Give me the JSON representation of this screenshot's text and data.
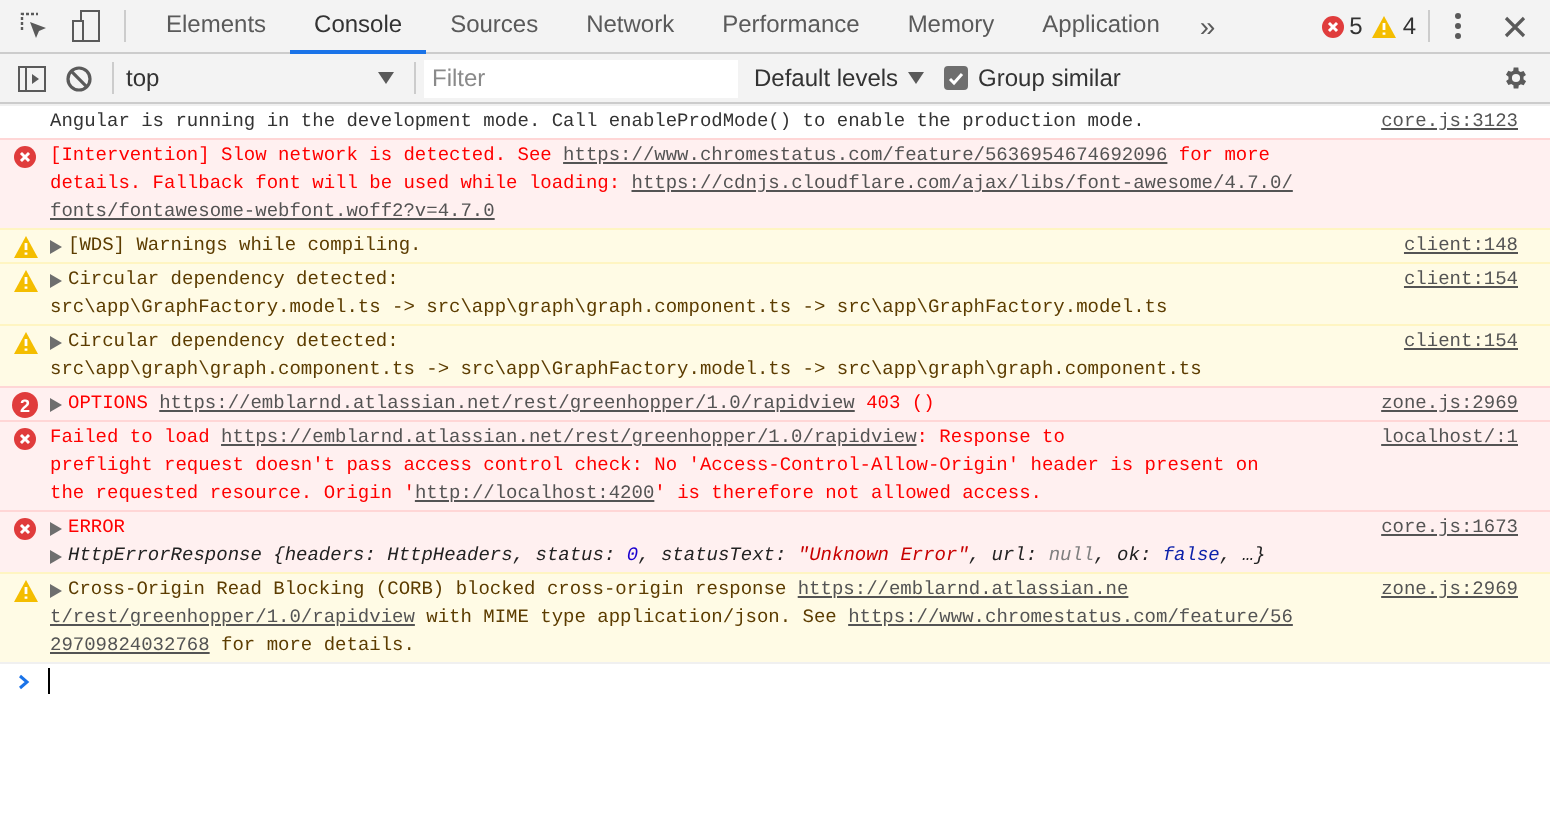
{
  "toolbar": {
    "tabs": [
      {
        "label": "Elements",
        "selected": false
      },
      {
        "label": "Console",
        "selected": true
      },
      {
        "label": "Sources",
        "selected": false
      },
      {
        "label": "Network",
        "selected": false
      },
      {
        "label": "Performance",
        "selected": false
      },
      {
        "label": "Memory",
        "selected": false
      },
      {
        "label": "Application",
        "selected": false
      }
    ],
    "overflow": "»",
    "error_count": "5",
    "warning_count": "4"
  },
  "filter_bar": {
    "context": "top",
    "filter_placeholder": "Filter",
    "levels": "Default levels",
    "group_similar": {
      "label": "Group similar",
      "checked": true
    }
  },
  "messages": [
    {
      "kind": "info",
      "source": "core.js:3123",
      "lines": [
        {
          "expander": false,
          "segments": [
            {
              "kind": "text",
              "text": "Angular is running in the development mode. Call enableProdMode() to enable the production mode."
            }
          ]
        }
      ]
    },
    {
      "kind": "error",
      "lines": [
        {
          "expander": false,
          "segments": [
            {
              "kind": "text",
              "text": "[Intervention] Slow network is detected. See "
            },
            {
              "kind": "link",
              "text": "https://www.chromestatus.com/feature/5636954674692096"
            },
            {
              "kind": "text",
              "text": " for more"
            }
          ]
        },
        {
          "expander": false,
          "segments": [
            {
              "kind": "text",
              "text": "details. Fallback font will be used while loading: "
            },
            {
              "kind": "link",
              "text": "https://cdnjs.cloudflare.com/ajax/libs/font-awesome/4.7.0/"
            }
          ]
        },
        {
          "expander": false,
          "segments": [
            {
              "kind": "link",
              "text": "fonts/fontawesome-webfont.woff2?v=4.7.0"
            }
          ]
        }
      ]
    },
    {
      "kind": "warning",
      "source": "client:148",
      "lines": [
        {
          "expander": true,
          "segments": [
            {
              "kind": "text",
              "text": "[WDS] Warnings while compiling."
            }
          ]
        }
      ]
    },
    {
      "kind": "warning",
      "source": "client:154",
      "lines": [
        {
          "expander": true,
          "segments": [
            {
              "kind": "text",
              "text": "Circular dependency detected:"
            }
          ]
        },
        {
          "expander": false,
          "segments": [
            {
              "kind": "text",
              "text": "src\\app\\GraphFactory.model.ts -> src\\app\\graph\\graph.component.ts -> src\\app\\GraphFactory.model.ts"
            }
          ]
        }
      ]
    },
    {
      "kind": "warning",
      "source": "client:154",
      "lines": [
        {
          "expander": true,
          "segments": [
            {
              "kind": "text",
              "text": "Circular dependency detected:"
            }
          ]
        },
        {
          "expander": false,
          "segments": [
            {
              "kind": "text",
              "text": "src\\app\\graph\\graph.component.ts -> src\\app\\GraphFactory.model.ts -> src\\app\\graph\\graph.component.ts"
            }
          ]
        }
      ]
    },
    {
      "kind": "error",
      "count": "2",
      "source": "zone.js:2969",
      "lines": [
        {
          "expander": true,
          "segments": [
            {
              "kind": "text",
              "text": "OPTIONS "
            },
            {
              "kind": "link",
              "text": "https://emblarnd.atlassian.net/rest/greenhopper/1.0/rapidview"
            },
            {
              "kind": "text",
              "text": " 403 ()"
            }
          ]
        }
      ]
    },
    {
      "kind": "error",
      "source": "localhost/:1",
      "lines": [
        {
          "expander": false,
          "segments": [
            {
              "kind": "text",
              "text": "Failed to load "
            },
            {
              "kind": "link",
              "text": "https://emblarnd.atlassian.net/rest/greenhopper/1.0/rapidview"
            },
            {
              "kind": "text",
              "text": ": Response to"
            }
          ]
        },
        {
          "expander": false,
          "segments": [
            {
              "kind": "text",
              "text": "preflight request doesn't pass access control check: No 'Access-Control-Allow-Origin' header is present on"
            }
          ]
        },
        {
          "expander": false,
          "segments": [
            {
              "kind": "text",
              "text": "the requested resource. Origin '"
            },
            {
              "kind": "link",
              "text": "http://localhost:4200"
            },
            {
              "kind": "text",
              "text": "' is therefore not allowed access."
            }
          ]
        }
      ]
    },
    {
      "kind": "error",
      "source": "core.js:1673",
      "lines": [
        {
          "expander": true,
          "segments": [
            {
              "kind": "text",
              "text": "ERROR"
            }
          ]
        },
        {
          "expander": true,
          "segments": [
            {
              "kind": "object",
              "text": "HttpErrorResponse {headers: HttpHeaders, status: "
            },
            {
              "kind": "number",
              "text": "0"
            },
            {
              "kind": "object",
              "text": ", statusText: "
            },
            {
              "kind": "string",
              "text": "\"Unknown Error\""
            },
            {
              "kind": "object",
              "text": ", url: "
            },
            {
              "kind": "null",
              "text": "null"
            },
            {
              "kind": "object",
              "text": ", ok: "
            },
            {
              "kind": "bool",
              "text": "false"
            },
            {
              "kind": "object",
              "text": ", …}"
            }
          ]
        }
      ]
    },
    {
      "kind": "warning",
      "source": "zone.js:2969",
      "lines": [
        {
          "expander": true,
          "segments": [
            {
              "kind": "text",
              "text": "Cross-Origin Read Blocking (CORB) blocked cross-origin response "
            },
            {
              "kind": "link",
              "text": "https://emblarnd.atlassian.ne"
            }
          ]
        },
        {
          "expander": false,
          "segments": [
            {
              "kind": "link",
              "text": "t/rest/greenhopper/1.0/rapidview"
            },
            {
              "kind": "text",
              "text": " with MIME type application/json. See "
            },
            {
              "kind": "link",
              "text": "https://www.chromestatus.com/feature/56"
            }
          ]
        },
        {
          "expander": false,
          "segments": [
            {
              "kind": "link",
              "text": "29709824032768"
            },
            {
              "kind": "text",
              "text": " for more details."
            }
          ]
        }
      ]
    }
  ]
}
